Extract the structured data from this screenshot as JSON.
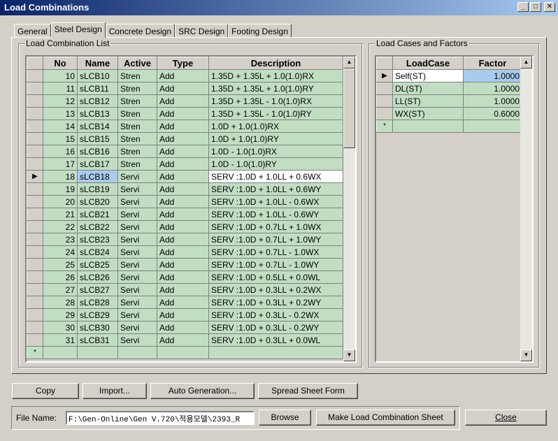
{
  "window": {
    "title": "Load Combinations"
  },
  "tabs": [
    "General",
    "Steel Design",
    "Concrete Design",
    "SRC Design",
    "Footing Design"
  ],
  "active_tab": "Steel Design",
  "combo_list": {
    "legend": "Load Combination List",
    "columns": [
      "No",
      "Name",
      "Active",
      "Type",
      "Description"
    ],
    "selected_no": "18",
    "rows": [
      {
        "no": "10",
        "name": "sLCB10",
        "active": "Stren",
        "type": "Add",
        "desc": "1.35D + 1.35L + 1.0(1.0)RX"
      },
      {
        "no": "11",
        "name": "sLCB11",
        "active": "Stren",
        "type": "Add",
        "desc": "1.35D + 1.35L + 1.0(1.0)RY"
      },
      {
        "no": "12",
        "name": "sLCB12",
        "active": "Stren",
        "type": "Add",
        "desc": "1.35D + 1.35L - 1.0(1.0)RX"
      },
      {
        "no": "13",
        "name": "sLCB13",
        "active": "Stren",
        "type": "Add",
        "desc": "1.35D + 1.35L - 1.0(1.0)RY"
      },
      {
        "no": "14",
        "name": "sLCB14",
        "active": "Stren",
        "type": "Add",
        "desc": "1.0D + 1.0(1.0)RX"
      },
      {
        "no": "15",
        "name": "sLCB15",
        "active": "Stren",
        "type": "Add",
        "desc": "1.0D + 1.0(1.0)RY"
      },
      {
        "no": "16",
        "name": "sLCB16",
        "active": "Stren",
        "type": "Add",
        "desc": "1.0D - 1.0(1.0)RX"
      },
      {
        "no": "17",
        "name": "sLCB17",
        "active": "Stren",
        "type": "Add",
        "desc": "1.0D - 1.0(1.0)RY"
      },
      {
        "no": "18",
        "name": "sLCB18",
        "active": "Servi",
        "type": "Add",
        "desc": "SERV :1.0D + 1.0LL + 0.6WX"
      },
      {
        "no": "19",
        "name": "sLCB19",
        "active": "Servi",
        "type": "Add",
        "desc": "SERV :1.0D + 1.0LL + 0.6WY"
      },
      {
        "no": "20",
        "name": "sLCB20",
        "active": "Servi",
        "type": "Add",
        "desc": "SERV :1.0D + 1.0LL - 0.6WX"
      },
      {
        "no": "21",
        "name": "sLCB21",
        "active": "Servi",
        "type": "Add",
        "desc": "SERV :1.0D + 1.0LL - 0.6WY"
      },
      {
        "no": "22",
        "name": "sLCB22",
        "active": "Servi",
        "type": "Add",
        "desc": "SERV :1.0D + 0.7LL + 1.0WX"
      },
      {
        "no": "23",
        "name": "sLCB23",
        "active": "Servi",
        "type": "Add",
        "desc": "SERV :1.0D + 0.7LL + 1.0WY"
      },
      {
        "no": "24",
        "name": "sLCB24",
        "active": "Servi",
        "type": "Add",
        "desc": "SERV :1.0D + 0.7LL - 1.0WX"
      },
      {
        "no": "25",
        "name": "sLCB25",
        "active": "Servi",
        "type": "Add",
        "desc": "SERV :1.0D + 0.7LL - 1.0WY"
      },
      {
        "no": "26",
        "name": "sLCB26",
        "active": "Servi",
        "type": "Add",
        "desc": "SERV :1.0D + 0.5LL + 0.0WL"
      },
      {
        "no": "27",
        "name": "sLCB27",
        "active": "Servi",
        "type": "Add",
        "desc": "SERV :1.0D + 0.3LL + 0.2WX"
      },
      {
        "no": "28",
        "name": "sLCB28",
        "active": "Servi",
        "type": "Add",
        "desc": "SERV :1.0D + 0.3LL + 0.2WY"
      },
      {
        "no": "29",
        "name": "sLCB29",
        "active": "Servi",
        "type": "Add",
        "desc": "SERV :1.0D + 0.3LL - 0.2WX"
      },
      {
        "no": "30",
        "name": "sLCB30",
        "active": "Servi",
        "type": "Add",
        "desc": "SERV :1.0D + 0.3LL - 0.2WY"
      },
      {
        "no": "31",
        "name": "sLCB31",
        "active": "Servi",
        "type": "Add",
        "desc": "SERV :1.0D + 0.3LL + 0.0WL"
      }
    ],
    "new_row_marker": "*"
  },
  "load_cases": {
    "legend": "Load Cases and Factors",
    "columns": [
      "LoadCase",
      "Factor"
    ],
    "rows": [
      {
        "case": "Self(ST)",
        "factor": "1.0000"
      },
      {
        "case": "DL(ST)",
        "factor": "1.0000"
      },
      {
        "case": "LL(ST)",
        "factor": "1.0000"
      },
      {
        "case": "WX(ST)",
        "factor": "0.6000"
      }
    ],
    "new_row_marker": "*"
  },
  "buttons": {
    "copy": "Copy",
    "import": "Import...",
    "auto_generation": "Auto Generation...",
    "spread_sheet": "Spread Sheet Form",
    "browse": "Browse",
    "make_sheet": "Make Load Combination Sheet",
    "close": "Close"
  },
  "file": {
    "label": "File Name:",
    "value": "F:\\Gen-Online\\Gen V.720\\적용모델\\2393_R"
  },
  "colors": {
    "cell_green": "#c1dec3",
    "selection_blue": "#a9cbee",
    "title_blue": "#0a246a"
  }
}
